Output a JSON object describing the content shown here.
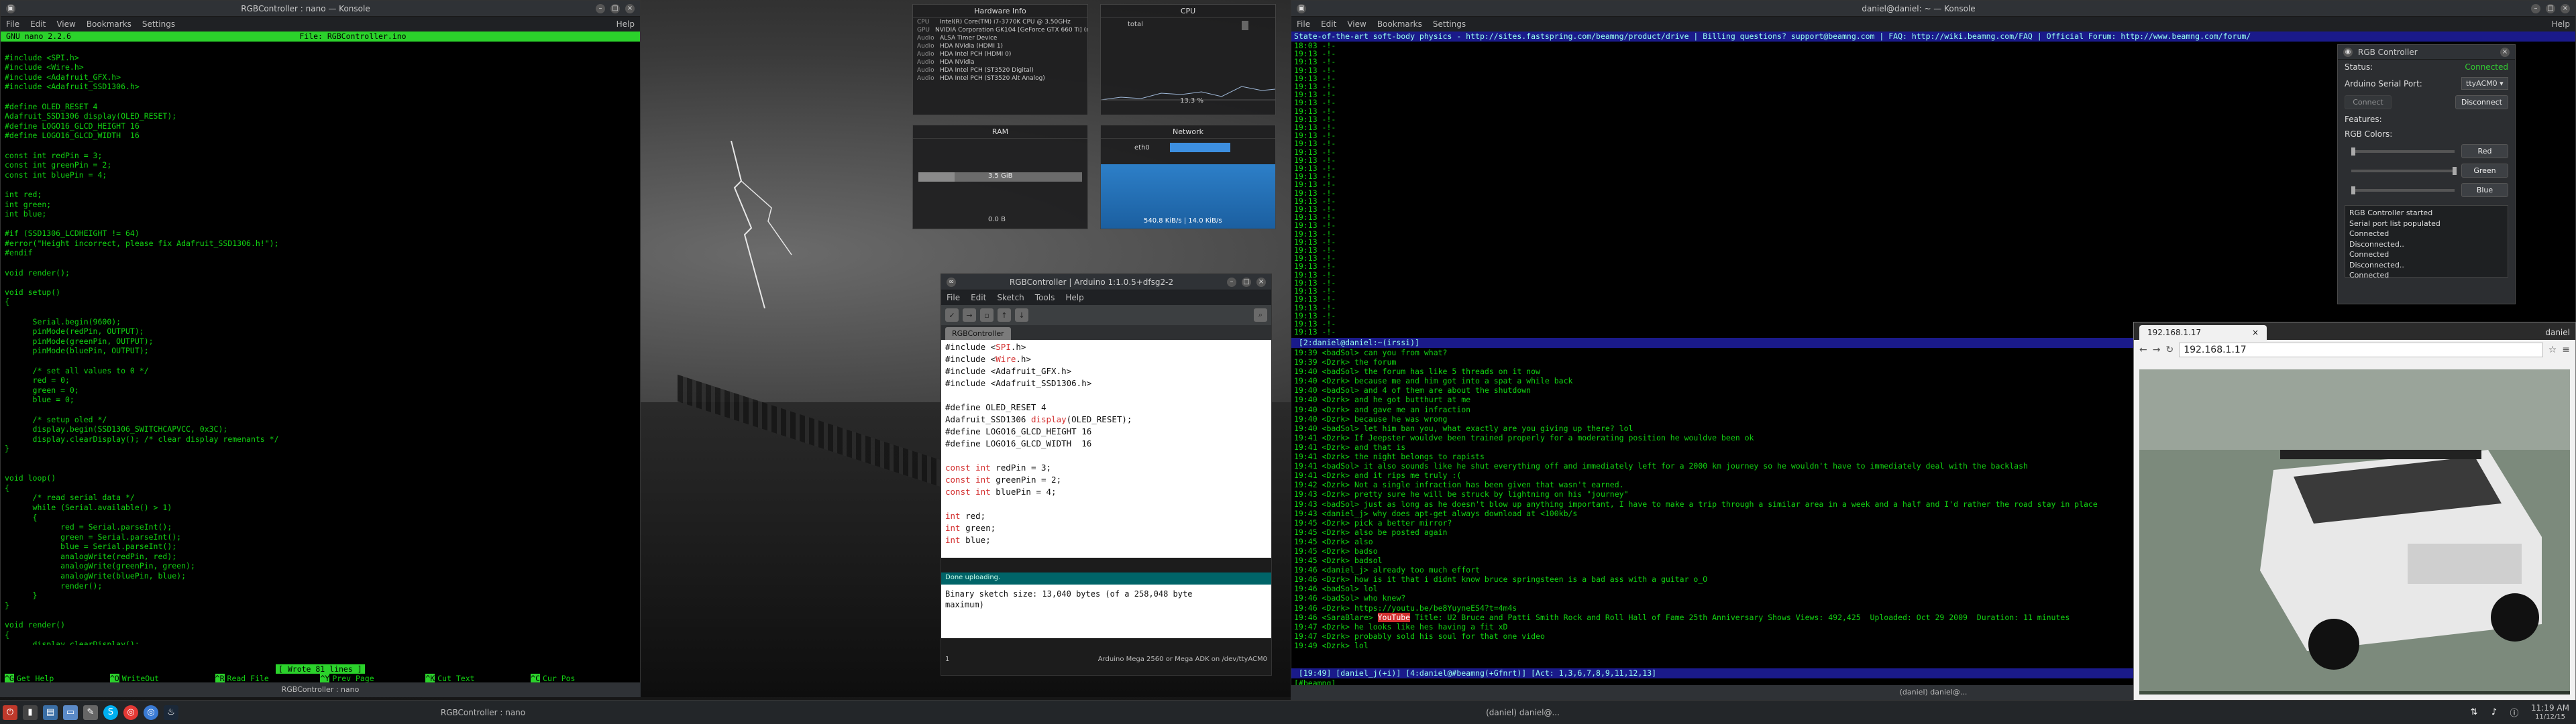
{
  "nano": {
    "window_title": "RGBController : nano — Konsole",
    "menu": [
      "File",
      "Edit",
      "View",
      "Bookmarks",
      "Settings",
      "Help"
    ],
    "header_left": "GNU nano 2.2.6",
    "header_right": "File: RGBController.ino",
    "code": "\n#include <SPI.h>\n#include <Wire.h>\n#include <Adafruit_GFX.h>\n#include <Adafruit_SSD1306.h>\n\n#define OLED_RESET 4\nAdafruit_SSD1306 display(OLED_RESET);\n#define LOGO16_GLCD_HEIGHT 16\n#define LOGO16_GLCD_WIDTH  16\n\nconst int redPin = 3;\nconst int greenPin = 2;\nconst int bluePin = 4;\n\nint red;\nint green;\nint blue;\n\n#if (SSD1306_LCDHEIGHT != 64)\n#error(\"Height incorrect, please fix Adafruit_SSD1306.h!\");\n#endif\n\nvoid render();\n\nvoid setup()\n{\n\n      Serial.begin(9600);\n      pinMode(redPin, OUTPUT);\n      pinMode(greenPin, OUTPUT);\n      pinMode(bluePin, OUTPUT);\n\n      /* set all values to 0 */\n      red = 0;\n      green = 0;\n      blue = 0;\n\n      /* setup oled */\n      display.begin(SSD1306_SWITCHCAPVCC, 0x3C);\n      display.clearDisplay(); /* clear display remenants */\n}\n\n\nvoid loop()\n{\n      /* read serial data */\n      while (Serial.available() > 1)\n      {\n            red = Serial.parseInt();\n            green = Serial.parseInt();\n            blue = Serial.parseInt();\n            analogWrite(redPin, red);\n            analogWrite(greenPin, green);\n            analogWrite(bluePin, blue);\n            render();\n      }\n}\n\nvoid render()\n{\n      display.clearDisplay();\n      display.setTextSize(2);\n      display.setTextColor(WHITE);\n      display.setCursor(0,0);",
    "status_msg": "[ Wrote 81 lines ]",
    "keys": [
      [
        "^G",
        "Get Help"
      ],
      [
        "^O",
        "WriteOut"
      ],
      [
        "^R",
        "Read File"
      ],
      [
        "^Y",
        "Prev Page"
      ],
      [
        "^K",
        "Cut Text"
      ],
      [
        "^C",
        "Cur Pos"
      ],
      [
        "^X",
        "Exit"
      ],
      [
        "^J",
        "Justify"
      ],
      [
        "^W",
        "Where Is"
      ],
      [
        "^V",
        "Next Page"
      ],
      [
        "^U",
        "UnCut Text"
      ],
      [
        "^T",
        "To Spell"
      ]
    ],
    "footer": "RGBController : nano"
  },
  "hardware": {
    "title": "Hardware Info",
    "rows": [
      [
        "CPU",
        "Intel(R) Core(TM) i7-3770K CPU @ 3.50GHz"
      ],
      [
        "GPU",
        "NVIDIA Corporation GK104 [GeForce GTX 660 Ti] (rev a1)"
      ],
      [
        "Audio",
        "ALSA Timer Device"
      ],
      [
        "Audio",
        "HDA NVidia (HDMI 1)"
      ],
      [
        "Audio",
        "HDA Intel PCH (HDMI 0)"
      ],
      [
        "Audio",
        "HDA NVidia"
      ],
      [
        "Audio",
        "HDA Intel PCH (ST3520 Digital)"
      ],
      [
        "Audio",
        "HDA Intel PCH (ST3520 Alt Analog)"
      ]
    ]
  },
  "cpu": {
    "title": "CPU",
    "label": "total",
    "value": "13.3 %"
  },
  "ram": {
    "title": "RAM",
    "used": "3.5 GiB",
    "swap": "0.0 B",
    "used_fraction": 0.22
  },
  "network": {
    "title": "Network",
    "iface": "eth0",
    "rate": "540.8 KiB/s | 14.0 KiB/s"
  },
  "arduino": {
    "title": "RGBController | Arduino 1:1.0.5+dfsg2-2",
    "menu": [
      "File",
      "Edit",
      "Sketch",
      "Tools",
      "Help"
    ],
    "tab": "RGBController",
    "code_lines": [
      [
        "#include <",
        "SPI",
        ".h>"
      ],
      [
        "#include <",
        "Wire",
        ".h>"
      ],
      [
        "#include <Adafruit_GFX.h>",
        "",
        ""
      ],
      [
        "#include <Adafruit_SSD1306.h>",
        "",
        ""
      ],
      [
        "",
        "",
        ""
      ],
      [
        "#define OLED_RESET 4",
        "",
        ""
      ],
      [
        "Adafruit_SSD1306 ",
        "display",
        "(OLED_RESET);"
      ],
      [
        "#define LOGO16_GLCD_HEIGHT 16",
        "",
        ""
      ],
      [
        "#define LOGO16_GLCD_WIDTH  16",
        "",
        ""
      ],
      [
        "",
        "",
        ""
      ],
      [
        "",
        "const int",
        " redPin = 3;"
      ],
      [
        "",
        "const int",
        " greenPin = 2;"
      ],
      [
        "",
        "const int",
        " bluePin = 4;"
      ],
      [
        "",
        "",
        ""
      ],
      [
        "",
        "int",
        " red;"
      ],
      [
        "",
        "int",
        " green;"
      ],
      [
        "",
        "int",
        " blue;"
      ]
    ],
    "status": "Done uploading.",
    "console": "Binary sketch size: 13,040 bytes (of a 258,048 byte\nmaximum)",
    "line_no": "1",
    "board": "Arduino Mega 2560 or Mega ADK on /dev/ttyACM0"
  },
  "irc": {
    "window_title": "daniel@daniel: ~ — Konsole",
    "menu": [
      "File",
      "Edit",
      "View",
      "Bookmarks",
      "Settings",
      "Help"
    ],
    "topic": "State-of-the-art soft-body physics - http://sites.fastspring.com/beamng/product/drive | Billing questions? support@beamng.com | FAQ: http://wiki.beamng.com/FAQ | Official Forum: http://www.beamng.com/forum/",
    "top_lines": [
      "18:03 -!-",
      "19:13 -!-",
      "19:13 -!-",
      "19:13 -!-",
      "19:13 -!-",
      "19:13 -!-",
      "19:13 -!-",
      "19:13 -!-",
      "19:13 -!-",
      "19:13 -!-",
      "19:13 -!-",
      "19:13 -!-",
      "19:13 -!-",
      "19:13 -!-",
      "19:13 -!-",
      "19:13 -!-",
      "19:13 -!-",
      "19:13 -!-",
      "19:13 -!-",
      "19:13 -!-",
      "19:13 -!-",
      "19:13 -!-",
      "19:13 -!-",
      "19:13 -!-",
      "19:13 -!-",
      "19:13 -!-",
      "19:13 -!-",
      "19:13 -!-",
      "19:13 -!-",
      "19:13 -!-",
      "19:13 -!-",
      "19:13 -!-",
      "19:13 -!-",
      "19:13 -!-",
      "19:13 -!-",
      "19:13 -!-"
    ],
    "mid_status": " [2:daniel@daniel:~(irssi)]",
    "lines": [
      "19:39 <badSol> can you from what?",
      "19:39 <Dzrk> the forum",
      "19:40 <badSol> the forum has like 5 threads on it now",
      "19:40 <Dzrk> because me and him got into a spat a while back",
      "19:40 <badSol> and 4 of them are about the shutdown",
      "19:40 <Dzrk> and he got butthurt at me",
      "19:40 <Dzrk> and gave me an infraction",
      "19:40 <Dzrk> because he was wrong",
      "19:40 <badSol> let him ban you, what exactly are you giving up there? lol",
      "19:41 <Dzrk> If Jeepster wouldve been trained properly for a moderating position he wouldve been ok",
      "19:41 <Dzrk> and that is",
      "19:41 <Dzrk> the night belongs to rapists",
      "19:41 <badSol> it also sounds like he shut everything off and immediately left for a 2000 km journey so he wouldn't have to immediately deal with the backlash",
      "19:41 <Dzrk> and it rips me truly :(",
      "19:42 <Dzrk> Not a single infraction has been given that wasn't earned.",
      "19:43 <Dzrk> pretty sure he will be struck by lightning on his \"journey\"",
      "19:43 <badSol> just as long as he doesn't blow up anything important, I have to make a trip through a similar area in a week and a half and I'd rather the road stay in place",
      "19:43 <daniel_j> why does apt-get always download at <100kb/s",
      "19:45 <Dzrk> pick a better mirror?",
      "19:45 <Dzrk> also be posted again",
      "19:45 <Dzrk> also",
      "19:45 <Dzrk> badso",
      "19:45 <Dzrk> badsol",
      "19:46 <daniel_j> already too much effort",
      "19:46 <Dzrk> how is it that i didnt know bruce springsteen is a bad ass with a guitar o_O",
      "19:46 <badSol> lol",
      "19:46 <badSol> who knew?",
      "19:46 <Dzrk> https://youtu.be/be8YuyneES4?t=4m4s",
      "19:46 <SaraBlare> ",
      "19:47 <Dzrk> he looks like hes having a fit xD",
      "19:47 <Dzrk> probably sold his soul for that one video",
      "19:49 <Dzrk> lol"
    ],
    "youtube_tag": "YouTube",
    "youtube_rest": " Title: U2 Bruce and Patti Smith Rock and Roll Hall of Fame 25th Anniversary Shows Views: 492,425  Uploaded: Oct 29 2009  Duration: 11 minutes",
    "status_bottom": " [19:49] [daniel_j(+i)] [4:daniel@#beamng(+Gfnrt)] [Act: 1,3,6,7,8,9,11,12,13]",
    "prompt": "[#beamng] ",
    "footer": "(daniel) daniel@..."
  },
  "rgb": {
    "title": "RGB Controller",
    "status_label": "Status:",
    "status_value": "Connected",
    "port_label": "Arduino Serial Port:",
    "port_value": "ttyACM0",
    "connect": "Connect",
    "disconnect": "Disconnect",
    "features_label": "Features:",
    "colors_label": "RGB Colors:",
    "red": "Red",
    "green": "Green",
    "blue": "Blue",
    "log": [
      "RGB Controller started",
      "Serial port list populated",
      "Connected",
      "Disconnected..",
      "Connected",
      "Disconnected..",
      "Connected"
    ]
  },
  "browser": {
    "tab": "192.168.1.17",
    "url": "192.168.1.17",
    "user": "daniel"
  },
  "taskbar": {
    "tasks": [
      "RGBController : nano",
      "(daniel) daniel@..."
    ],
    "time": "11:19 AM",
    "date": "11/12/15"
  }
}
